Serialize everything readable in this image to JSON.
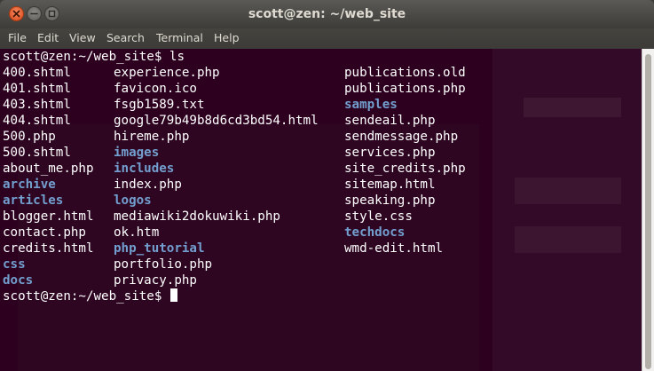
{
  "window": {
    "title": "scott@zen: ~/web_site"
  },
  "menubar": {
    "items": [
      "File",
      "Edit",
      "View",
      "Search",
      "Terminal",
      "Help"
    ]
  },
  "terminal": {
    "prompt1": "scott@zen:~/web_site$ ls",
    "prompt2": "scott@zen:~/web_site$ ",
    "rows": [
      [
        {
          "t": "400.shtml",
          "d": false
        },
        {
          "t": "experience.php",
          "d": false
        },
        {
          "t": "publications.old",
          "d": false
        }
      ],
      [
        {
          "t": "401.shtml",
          "d": false
        },
        {
          "t": "favicon.ico",
          "d": false
        },
        {
          "t": "publications.php",
          "d": false
        }
      ],
      [
        {
          "t": "403.shtml",
          "d": false
        },
        {
          "t": "fsgb1589.txt",
          "d": false
        },
        {
          "t": "samples",
          "d": true
        }
      ],
      [
        {
          "t": "404.shtml",
          "d": false
        },
        {
          "t": "google79b49b8d6cd3bd54.html",
          "d": false
        },
        {
          "t": "sendeail.php",
          "d": false
        }
      ],
      [
        {
          "t": "500.php",
          "d": false
        },
        {
          "t": "hireme.php",
          "d": false
        },
        {
          "t": "sendmessage.php",
          "d": false
        }
      ],
      [
        {
          "t": "500.shtml",
          "d": false
        },
        {
          "t": "images",
          "d": true
        },
        {
          "t": "services.php",
          "d": false
        }
      ],
      [
        {
          "t": "about_me.php",
          "d": false
        },
        {
          "t": "includes",
          "d": true
        },
        {
          "t": "site_credits.php",
          "d": false
        }
      ],
      [
        {
          "t": "archive",
          "d": true
        },
        {
          "t": "index.php",
          "d": false
        },
        {
          "t": "sitemap.html",
          "d": false
        }
      ],
      [
        {
          "t": "articles",
          "d": true
        },
        {
          "t": "logos",
          "d": true
        },
        {
          "t": "speaking.php",
          "d": false
        }
      ],
      [
        {
          "t": "blogger.html",
          "d": false
        },
        {
          "t": "mediawiki2dokuwiki.php",
          "d": false
        },
        {
          "t": "style.css",
          "d": false
        }
      ],
      [
        {
          "t": "contact.php",
          "d": false
        },
        {
          "t": "ok.htm",
          "d": false
        },
        {
          "t": "techdocs",
          "d": true
        }
      ],
      [
        {
          "t": "credits.html",
          "d": false
        },
        {
          "t": "php_tutorial",
          "d": true
        },
        {
          "t": "wmd-edit.html",
          "d": false
        }
      ],
      [
        {
          "t": "css",
          "d": true
        },
        {
          "t": "portfolio.php",
          "d": false
        },
        {
          "t": "",
          "d": false
        }
      ],
      [
        {
          "t": "docs",
          "d": true
        },
        {
          "t": "privacy.php",
          "d": false
        },
        {
          "t": "",
          "d": false
        }
      ]
    ]
  },
  "colors": {
    "background": "#2c001e",
    "foreground": "#ffffff",
    "directory": "#729fcf"
  },
  "icons": {
    "close": "close-icon",
    "minimize": "minimize-icon",
    "maximize": "maximize-icon"
  }
}
